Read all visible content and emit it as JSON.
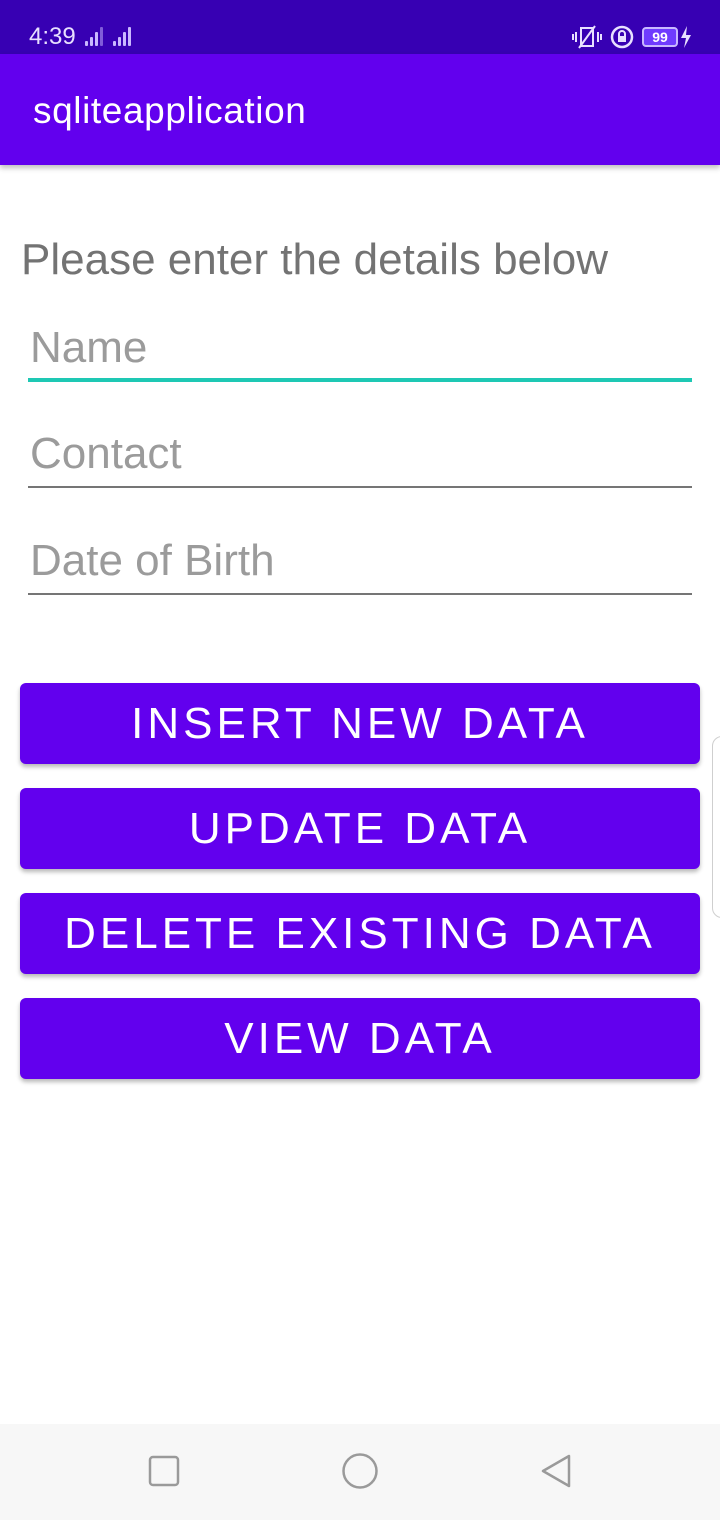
{
  "status_bar": {
    "time": "4:39",
    "battery": "99",
    "icons": [
      "signal-icon",
      "signal-icon",
      "vibrate-icon",
      "rotation-lock-icon",
      "battery-icon",
      "charging-icon"
    ]
  },
  "app_bar": {
    "title": "sqliteapplication"
  },
  "form": {
    "heading": "Please enter the details below",
    "name": {
      "placeholder": "Name",
      "value": ""
    },
    "contact": {
      "placeholder": "Contact",
      "value": ""
    },
    "dob": {
      "placeholder": "Date of Birth",
      "value": ""
    }
  },
  "buttons": {
    "insert": "INSERT NEW DATA",
    "update": "UPDATE DATA",
    "delete": "DELETE EXISTING DATA",
    "view": "VIEW DATA"
  },
  "nav_bar": {
    "icons": [
      "recents-icon",
      "home-icon",
      "back-icon"
    ]
  },
  "colors": {
    "primary": "#6200ee",
    "primary_dark": "#3700b3",
    "accent": "#1ec8b4"
  }
}
